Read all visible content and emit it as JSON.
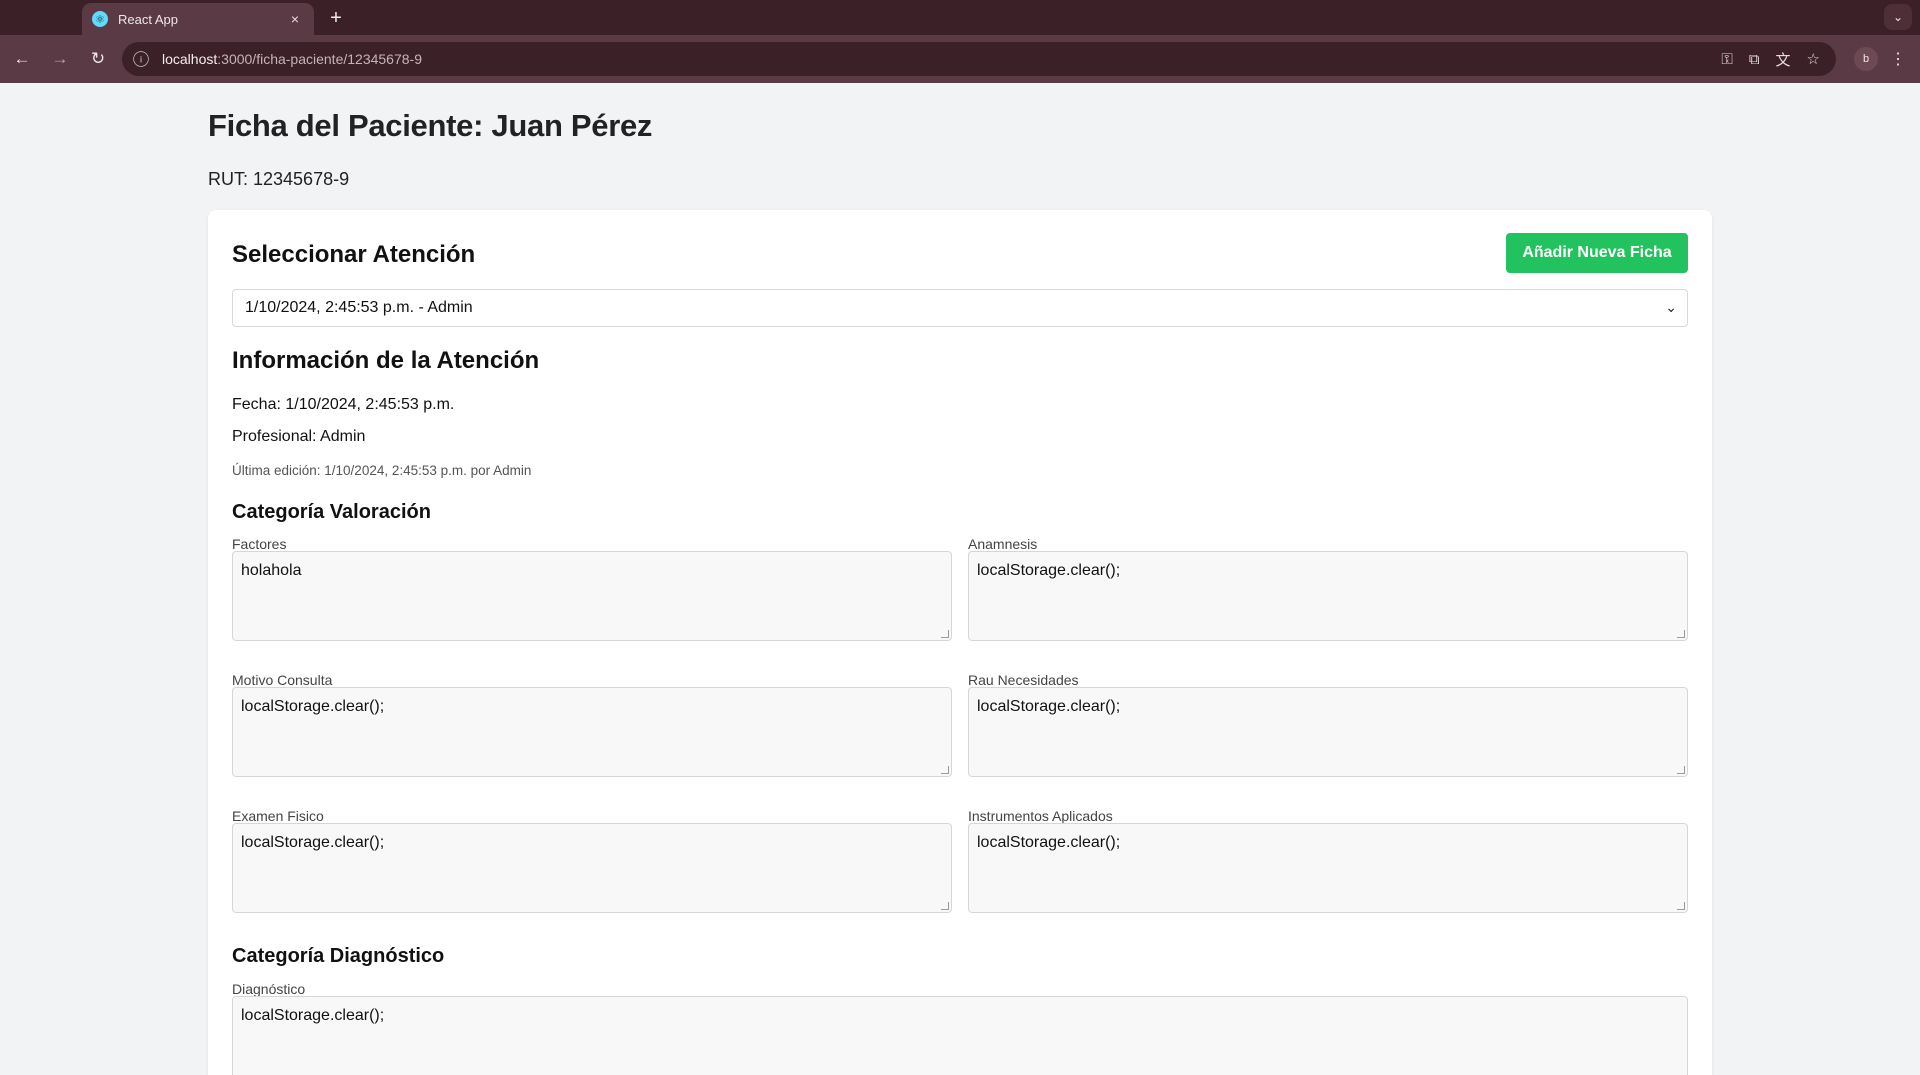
{
  "browser": {
    "tab_title": "React App",
    "tab_close": "×",
    "new_tab": "+",
    "url_host": "localhost",
    "url_path": ":3000/ficha-paciente/12345678-9",
    "profile_initial": "b",
    "icons": [
      "back-arrow",
      "forward-arrow",
      "reload",
      "site-info",
      "password-key",
      "install-app",
      "translate",
      "bookmark-star",
      "menu-kebab"
    ]
  },
  "header": {
    "title": "Ficha del Paciente: Juan Pérez",
    "rut": "RUT: 12345678-9"
  },
  "selector": {
    "title": "Seleccionar Atención",
    "add_button": "Añadir Nueva Ficha",
    "selected": "1/10/2024, 2:45:53 p.m. - Admin"
  },
  "info": {
    "title": "Información de la Atención",
    "fecha": "Fecha: 1/10/2024, 2:45:53 p.m.",
    "profesional": "Profesional: Admin",
    "last_edit": "Última edición: 1/10/2024, 2:45:53 p.m. por Admin"
  },
  "valoracion": {
    "title": "Categoría Valoración",
    "fields": [
      {
        "label": "Factores",
        "value": "holahola"
      },
      {
        "label": "Anamnesis",
        "value": "localStorage.clear();"
      },
      {
        "label": "Motivo Consulta",
        "value": "localStorage.clear();"
      },
      {
        "label": "Rau Necesidades",
        "value": "localStorage.clear();"
      },
      {
        "label": "Examen Fisico",
        "value": "localStorage.clear();"
      },
      {
        "label": "Instrumentos Aplicados",
        "value": "localStorage.clear();"
      }
    ]
  },
  "diagnostico": {
    "title": "Categoría Diagnóstico",
    "label": "Diagnóstico",
    "value": "localStorage.clear();"
  },
  "colors": {
    "accent_button": "#22c35e",
    "chrome_bg": "#3b2027",
    "page_bg": "#f2f3f5"
  }
}
